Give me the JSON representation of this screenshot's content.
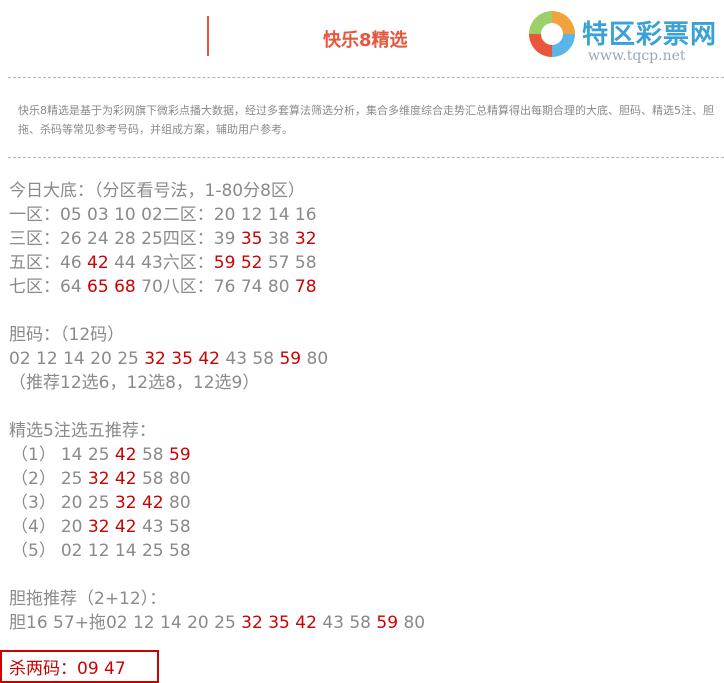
{
  "header": {
    "title": "快乐8精选",
    "logo_name": "特区彩票网",
    "logo_url": "www.tqcp.net"
  },
  "intro": "快乐8精选是基于为彩网旗下微彩点播大数据，经过多套算法筛选分析，集合多维度综合走势汇总精算得出每期合理的大底、胆码、精选5注、胆拖、杀码等常见参考号码，并组成方案，辅助用户参考。",
  "big_base": {
    "title": "今日大底：（分区看号法，1-80分8区）",
    "rows": [
      {
        "segments": [
          {
            "label": "一区：",
            "numbers": [
              "05",
              "03",
              "10",
              "02"
            ]
          },
          {
            "label": "二区：",
            "numbers": [
              "20",
              "12",
              "14",
              "16"
            ]
          }
        ]
      },
      {
        "segments": [
          {
            "label": "三区：",
            "numbers": [
              "26",
              "24",
              "28",
              "25"
            ]
          },
          {
            "label": "四区：",
            "numbers": [
              "39",
              "35",
              "38",
              "32"
            ]
          }
        ]
      },
      {
        "segments": [
          {
            "label": "五区：",
            "numbers": [
              "46",
              "42",
              "44",
              "43"
            ]
          },
          {
            "label": "六区：",
            "numbers": [
              "59",
              "52",
              "57",
              "58"
            ]
          }
        ]
      },
      {
        "segments": [
          {
            "label": "七区：",
            "numbers": [
              "64",
              "65",
              "68",
              "70"
            ]
          },
          {
            "label": "八区：",
            "numbers": [
              "76",
              "74",
              "80",
              "78"
            ]
          }
        ]
      }
    ]
  },
  "dan_ma": {
    "title": "胆码：（12码）",
    "numbers": [
      "02",
      "12",
      "14",
      "20",
      "25",
      "32",
      "35",
      "42",
      "43",
      "58",
      "59",
      "80"
    ],
    "note": "（推荐12选6，12选8，12选9）"
  },
  "jingxuan": {
    "title": "精选5注选五推荐：",
    "items": [
      {
        "idx": "（1）",
        "numbers": [
          "14",
          "25",
          "42",
          "58",
          "59"
        ]
      },
      {
        "idx": "（2）",
        "numbers": [
          "25",
          "32",
          "42",
          "58",
          "80"
        ]
      },
      {
        "idx": "（3）",
        "numbers": [
          "20",
          "25",
          "32",
          "42",
          "80"
        ]
      },
      {
        "idx": "（4）",
        "numbers": [
          "20",
          "32",
          "42",
          "43",
          "58"
        ]
      },
      {
        "idx": "（5）",
        "numbers": [
          "02",
          "12",
          "14",
          "25",
          "58"
        ]
      }
    ]
  },
  "dantuo": {
    "title": "胆拖推荐（2+12）：",
    "dan_label": "胆",
    "dan_numbers": [
      "16",
      "57"
    ],
    "tuo_label": "+拖",
    "tuo_numbers": [
      "02",
      "12",
      "14",
      "20",
      "25",
      "32",
      "35",
      "42",
      "43",
      "58",
      "59",
      "80"
    ]
  },
  "kill": {
    "text": "杀两码：09 47"
  },
  "highlight_numbers": [
    "32",
    "35",
    "42",
    "59",
    "52",
    "65",
    "68",
    "78"
  ],
  "colors": {
    "accent": "#e8563c",
    "highlight": "#cc0000",
    "text": "#8a8a8a"
  }
}
